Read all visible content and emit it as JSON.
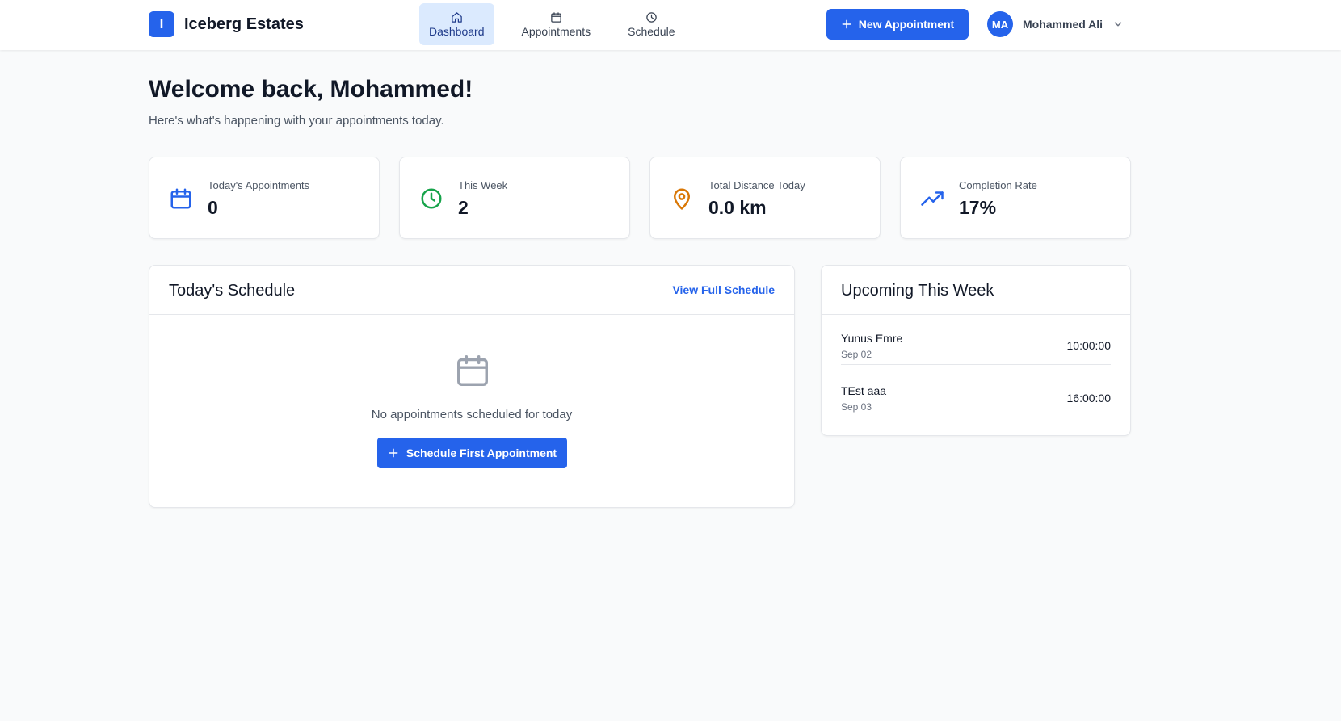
{
  "app": {
    "logo_letter": "I",
    "name": "Iceberg Estates"
  },
  "nav": [
    {
      "label": "Dashboard",
      "icon": "home-icon",
      "active": true
    },
    {
      "label": "Appointments",
      "icon": "calendar-icon",
      "active": false
    },
    {
      "label": "Schedule",
      "icon": "clock-icon",
      "active": false
    }
  ],
  "header": {
    "new_appointment_label": "New Appointment"
  },
  "user": {
    "initials": "MA",
    "name": "Mohammed Ali"
  },
  "welcome": {
    "title": "Welcome back, Mohammed!",
    "subtitle": "Here's what's happening with your appointments today."
  },
  "stats": [
    {
      "label": "Today's Appointments",
      "value": "0",
      "icon": "calendar-icon",
      "color": "#2563eb"
    },
    {
      "label": "This Week",
      "value": "2",
      "icon": "clock-icon",
      "color": "#16a34a"
    },
    {
      "label": "Total Distance Today",
      "value": "0.0 km",
      "icon": "map-pin-icon",
      "color": "#d97706"
    },
    {
      "label": "Completion Rate",
      "value": "17%",
      "icon": "trending-up-icon",
      "color": "#2563eb"
    }
  ],
  "today_schedule": {
    "title": "Today's Schedule",
    "view_link": "View Full Schedule",
    "empty_text": "No appointments scheduled for today",
    "button_label": "Schedule First Appointment"
  },
  "upcoming": {
    "title": "Upcoming This Week",
    "items": [
      {
        "name": "Yunus Emre",
        "date": "Sep 02",
        "time": "10:00:00"
      },
      {
        "name": "TEst aaa",
        "date": "Sep 03",
        "time": "16:00:00"
      }
    ]
  },
  "colors": {
    "primary": "#2563eb",
    "active_nav_bg": "#dbeafe",
    "background": "#f9fafb"
  }
}
